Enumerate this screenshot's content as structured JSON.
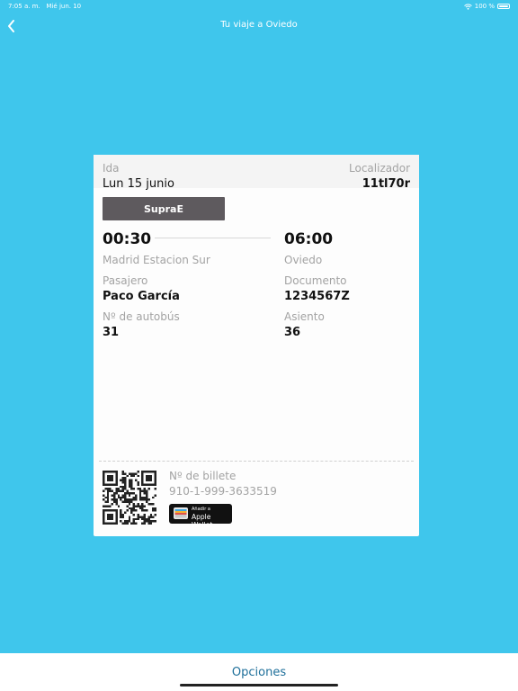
{
  "status": {
    "time": "7:05 a. m.",
    "date": "Mié jun. 10",
    "battery": "100 %"
  },
  "nav": {
    "title": "Tu viaje a Oviedo"
  },
  "ticket": {
    "direction_label": "Ida",
    "date": "Lun 15 junio",
    "locator_label": "Localizador",
    "locator": "11tl70r",
    "service": "SupraE",
    "departure_time": "00:30",
    "arrival_time": "06:00",
    "origin": "Madrid Estacion Sur",
    "destination": "Oviedo",
    "passenger_label": "Pasajero",
    "passenger": "Paco García",
    "document_label": "Documento",
    "document": "1234567Z",
    "bus_label": "Nº de autobús",
    "bus": "31",
    "seat_label": "Asiento",
    "seat": "36",
    "ticket_number_label": "Nº de billete",
    "ticket_number": "910-1-999-3633519",
    "wallet_small": "Añadir a",
    "wallet_big": "Apple Wallet"
  },
  "bottom": {
    "options_label": "Opciones"
  },
  "icons": {
    "back": "chevron-left-icon",
    "wifi": "wifi-icon",
    "battery": "battery-icon",
    "qr": "qr-code-icon",
    "wallet": "wallet-icon"
  },
  "colors": {
    "background": "#3fc6ec",
    "badge": "#5e5a5e",
    "link": "#1e6f9a"
  }
}
